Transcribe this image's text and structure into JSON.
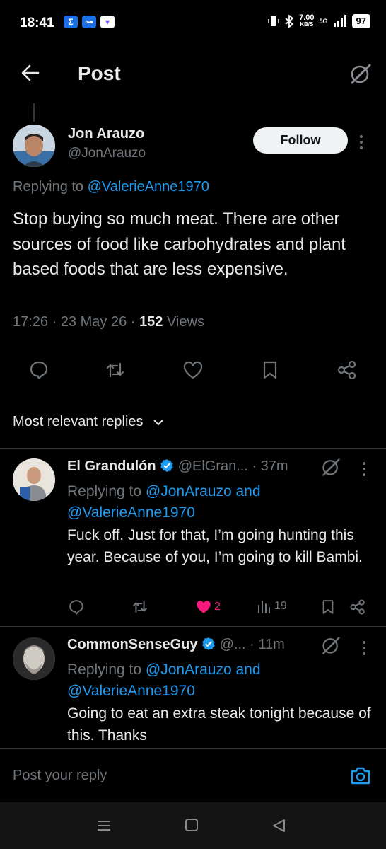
{
  "status_bar": {
    "time": "18:41",
    "app_badges": [
      "Σ",
      "⊶",
      "▾"
    ],
    "net_speed": "7.00",
    "net_unit": "KB/S",
    "network": "5G",
    "battery": "97"
  },
  "header": {
    "title": "Post"
  },
  "post": {
    "author_name": "Jon Arauzo",
    "author_handle": "@JonArauzo",
    "follow_label": "Follow",
    "replying_prefix": "Replying to",
    "replying_to": "@ValerieAnne1970",
    "text": "Stop buying so much meat. There are other sources of food like carbohydrates and plant based foods that are less expensive.",
    "time": "17:26",
    "date": "23 May 26",
    "views_count": "152",
    "views_label": "Views"
  },
  "sort": {
    "label": "Most relevant replies"
  },
  "replies": [
    {
      "name": "El Grandulón",
      "handle": "@ElGran...",
      "age": "· 37m",
      "replying_prefix": "Replying to",
      "replying_to_1": "@JonArauzo",
      "replying_and": "and",
      "replying_to_2": "@ValerieAnne1970",
      "text": "Fuck off. Just for that, I’m going hunting this year. Because of you, I’m going to kill Bambi.",
      "likes": "2",
      "views": "19"
    },
    {
      "name": "CommonSenseGuy",
      "handle": "@...",
      "age": "· 11m",
      "replying_prefix": "Replying to",
      "replying_to_1": "@JonArauzo",
      "replying_and": "and",
      "replying_to_2": "@ValerieAnne1970",
      "text": "Going to eat an extra steak tonight because of this. Thanks"
    }
  ],
  "compose": {
    "placeholder": "Post your reply"
  },
  "colors": {
    "background": "#000000",
    "link": "#1d9bf0",
    "like": "#f91880",
    "muted": "#71767b",
    "verified": "#1d9bf0"
  }
}
